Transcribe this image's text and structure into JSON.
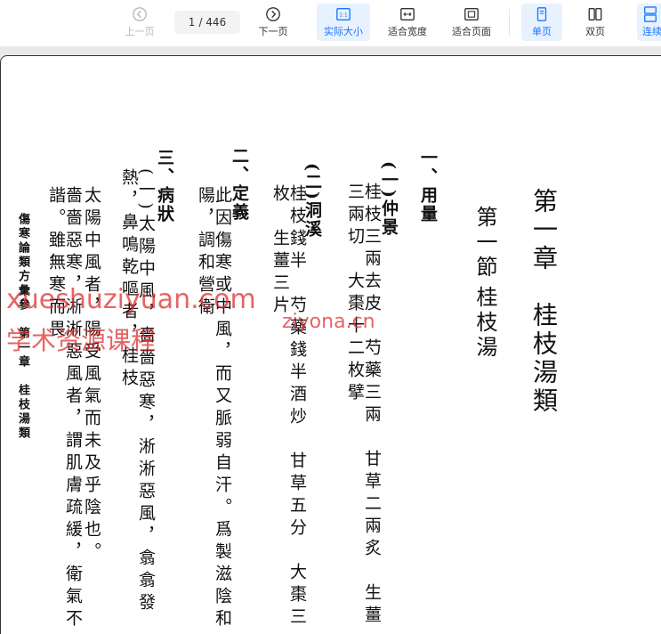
{
  "toolbar": {
    "prev_label": "上一页",
    "current_page": "1",
    "total_pages": "/ 446",
    "next_label": "下一页",
    "actual_size_label": "实际大小",
    "fit_width_label": "适合宽度",
    "fit_page_label": "适合页面",
    "single_page_label": "单页",
    "double_page_label": "双页",
    "continuous_label": "连续"
  },
  "document": {
    "chapter_title": "第一章　桂枝湯類",
    "section_1": "第一節",
    "section_1_name": "桂枝湯",
    "h1": "一、用量",
    "h1_sub1": "(一)仲景",
    "h1_sub1_line": "桂枝三兩去皮　芍藥三兩　甘草二兩炙　生薑三兩切　大棗十二枚擘",
    "h1_sub2": "(二)洞溪",
    "h1_sub2_line": "桂枝錢半　芍藥錢半酒炒　甘草五分　大棗三枚　生薑三片",
    "h2": "二、定義",
    "h2_line": "此因傷寒或中風，而又脈弱自汗。爲製滋陰和陽，調和營衛",
    "h3": "三、病狀",
    "h3_line1": "(一)太陽中風，嗇嗇惡寒，淅淅惡風，翕翕發熱，鼻鳴乾嘔者，桂枝",
    "h3_line2": "太陽中風者，陽受風氣而未及乎陰也。",
    "h3_line3": "嗇嗇惡寒，淅淅惡風者，謂肌膚疏緩，衛氣不諧。雖無寒而畏",
    "footer": "傷寒論類方彙參　第一章　桂枝湯類"
  },
  "watermarks": {
    "line1": "xueshuziyuan.com",
    "line2": "学术资源课程",
    "line3": "ziyona.cn"
  },
  "colors": {
    "accent": "#1677ff",
    "active_bg": "#e8f2ff",
    "watermark": "#dc2828"
  }
}
